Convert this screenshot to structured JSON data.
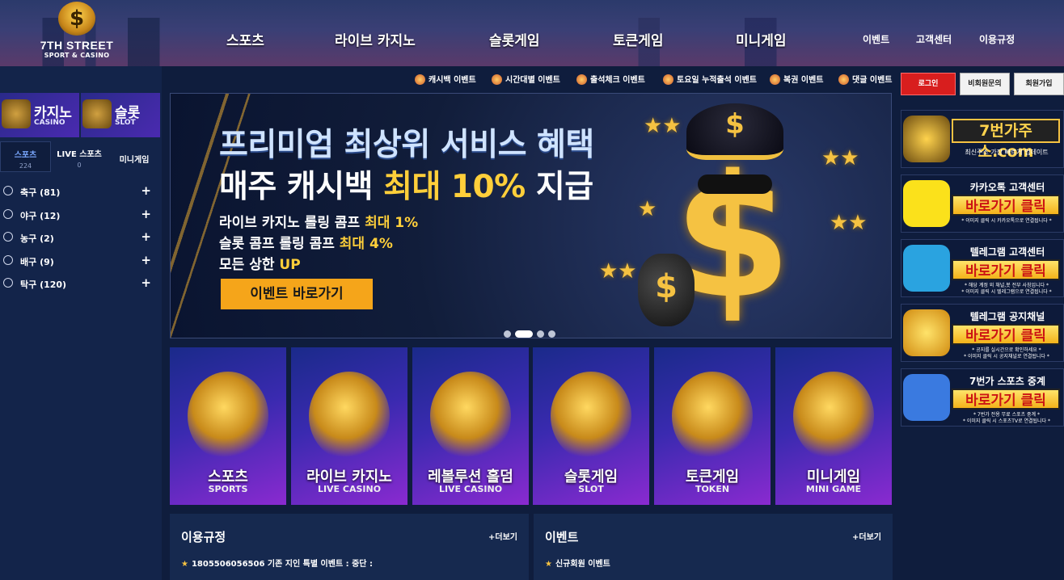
{
  "logo": {
    "name": "7TH STREET",
    "sub": "SPORT & CASINO"
  },
  "nav": [
    "스포츠",
    "라이브 카지노",
    "슬롯게임",
    "토큰게임",
    "미니게임"
  ],
  "top_links": [
    "이벤트",
    "고객센터",
    "이용규정"
  ],
  "sidebar": {
    "tiles": [
      {
        "title": "카지노",
        "sub": "CASINO"
      },
      {
        "title": "슬롯",
        "sub": "SLOT"
      }
    ],
    "tabs": [
      {
        "label": "스포츠",
        "count": "224"
      },
      {
        "label": "LIVE 스포츠",
        "count": "0"
      },
      {
        "label": "미니게임",
        "count": ""
      }
    ],
    "sports": [
      {
        "label": "축구 (81)",
        "icon": "soccer-icon"
      },
      {
        "label": "야구 (12)",
        "icon": "baseball-icon"
      },
      {
        "label": "농구 (2)",
        "icon": "basketball-icon"
      },
      {
        "label": "배구 (9)",
        "icon": "volleyball-icon"
      },
      {
        "label": "탁구 (120)",
        "icon": "table-tennis-icon"
      }
    ]
  },
  "event_menu": [
    "캐시백 이벤트",
    "시간대별 이벤트",
    "출석체크 이벤트",
    "토요일 누적출석 이벤트",
    "복권 이벤트",
    "댓글 이벤트"
  ],
  "banner": {
    "line1": "프리미엄 최상위 서비스 혜택",
    "line2_a": "매주 캐시백 ",
    "line2_b": "최대 10%",
    "line2_c": " 지급",
    "l3_a": "라이브 카지노 롤링 콤프 ",
    "l3_b": "최대 1%",
    "l4_a": "슬롯 콤프 롤링 콤프 ",
    "l4_b": "최대 4%",
    "l5_a": "모든 상한 ",
    "l5_b": "UP",
    "cta": "이벤트 바로가기",
    "slides": 4,
    "active_slide": 2
  },
  "games": [
    {
      "title": "스포츠",
      "sub": "SPORTS"
    },
    {
      "title": "라이브 카지노",
      "sub": "LIVE CASINO"
    },
    {
      "title": "레볼루션 홀덤",
      "sub": "LIVE CASINO"
    },
    {
      "title": "슬롯게임",
      "sub": "SLOT"
    },
    {
      "title": "토큰게임",
      "sub": "TOKEN"
    },
    {
      "title": "미니게임",
      "sub": "MINI GAME"
    }
  ],
  "boards": [
    {
      "title": "이용규정",
      "more": "+더보기",
      "item": "1805506056506 기존 지인 특별 이벤트 : 중단 :"
    },
    {
      "title": "이벤트",
      "more": "+더보기",
      "item": "신규회원 이벤트"
    }
  ],
  "auth": [
    "로그인",
    "비회원문의",
    "회원가입"
  ],
  "promos": [
    {
      "big": "7번가주소.com",
      "note": "최신주소 가장 빠르게 업데이트"
    },
    {
      "title": "카카오톡 고객센터",
      "cta": "바로가기 클릭",
      "note": "* 이미지 클릭 시 카카오톡으로 연결됩니다 *"
    },
    {
      "title": "텔레그램 고객센터",
      "cta": "바로가기 클릭",
      "note": "* 해당 계정 외 채널,봇 전부 사칭입니다 *\n* 이미지 클릭 시 텔레그램으로 연결됩니다 *"
    },
    {
      "title": "텔레그램 공지채널",
      "cta": "바로가기 클릭",
      "note": "* 공지를 실시간으로 확인하세요 *\n* 이미지 클릭 시 공지채널로 연결됩니다 *"
    },
    {
      "title": "7번가 스포츠 중계",
      "cta": "바로가기 클릭",
      "note": "* 7번가 전용 무료 스포츠 중계 *\n* 이미지 클릭 시 스포츠TV로 연결됩니다 *"
    }
  ],
  "colors": {
    "bg": "#0f1d3d",
    "gold": "#ffcf3a",
    "cta": "#f5a51a",
    "login": "#d81e1e"
  }
}
